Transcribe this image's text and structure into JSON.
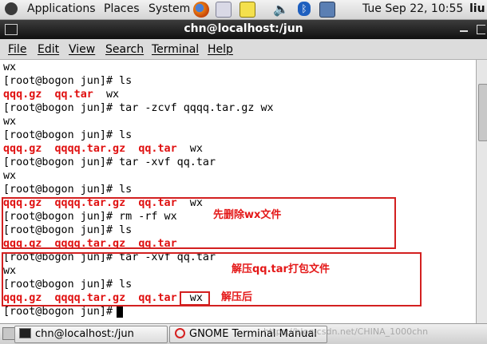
{
  "top_panel": {
    "applications": "Applications",
    "places": "Places",
    "system": "System",
    "clock": "Tue Sep 22, 10:55",
    "user": "liu"
  },
  "window": {
    "title": "chn@localhost:/jun",
    "menu": [
      "File",
      "Edit",
      "View",
      "Search",
      "Terminal",
      "Help"
    ]
  },
  "terminal": {
    "lines": [
      [
        {
          "t": "wx"
        }
      ],
      [
        {
          "t": "[root@bogon jun]# ls"
        }
      ],
      [
        {
          "t": "qqq.gz",
          "c": "red"
        },
        {
          "t": "  "
        },
        {
          "t": "qq.tar",
          "c": "red"
        },
        {
          "t": "  wx"
        }
      ],
      [
        {
          "t": "[root@bogon jun]# tar -zcvf qqqq.tar.gz wx"
        }
      ],
      [
        {
          "t": "wx"
        }
      ],
      [
        {
          "t": "[root@bogon jun]# ls"
        }
      ],
      [
        {
          "t": "qqq.gz",
          "c": "red"
        },
        {
          "t": "  "
        },
        {
          "t": "qqqq.tar.gz",
          "c": "red"
        },
        {
          "t": "  "
        },
        {
          "t": "qq.tar",
          "c": "red"
        },
        {
          "t": "  wx"
        }
      ],
      [
        {
          "t": "[root@bogon jun]# tar -xvf qq.tar"
        }
      ],
      [
        {
          "t": "wx"
        }
      ],
      [
        {
          "t": "[root@bogon jun]# ls"
        }
      ],
      [
        {
          "t": "qqq.gz",
          "c": "red"
        },
        {
          "t": "  "
        },
        {
          "t": "qqqq.tar.gz",
          "c": "red"
        },
        {
          "t": "  "
        },
        {
          "t": "qq.tar",
          "c": "red"
        },
        {
          "t": "  wx"
        }
      ],
      [
        {
          "t": "[root@bogon jun]# rm -rf wx"
        }
      ],
      [
        {
          "t": "[root@bogon jun]# ls"
        }
      ],
      [
        {
          "t": "qqq.gz",
          "c": "red"
        },
        {
          "t": "  "
        },
        {
          "t": "qqqq.tar.gz",
          "c": "red"
        },
        {
          "t": "  "
        },
        {
          "t": "qq.tar",
          "c": "red"
        }
      ],
      [
        {
          "t": "[root@bogon jun]# tar -xvf qq.tar"
        }
      ],
      [
        {
          "t": "wx"
        }
      ],
      [
        {
          "t": "[root@bogon jun]# ls"
        }
      ],
      [
        {
          "t": "qqq.gz",
          "c": "red"
        },
        {
          "t": "  "
        },
        {
          "t": "qqqq.tar.gz",
          "c": "red"
        },
        {
          "t": "  "
        },
        {
          "t": "qq.tar",
          "c": "red"
        },
        {
          "t": "  wx"
        }
      ],
      [
        {
          "t": "[root@bogon jun]# "
        }
      ]
    ]
  },
  "annotations": {
    "delete_wx": "先删除wx文件",
    "extract_tar": "解压qq.tar打包文件",
    "after_extract": "解压后"
  },
  "taskbar": {
    "task1": "chn@localhost:/jun",
    "task2": "GNOME Terminal Manual"
  },
  "watermark": "https://blog.csdn.net/CHINA_1000chn",
  "colors": {
    "file_red": "#e01010",
    "annotation_red": "#d32020"
  },
  "icons": [
    "gnome-foot-icon",
    "firefox-icon",
    "mail-icon",
    "notes-icon",
    "volume-icon",
    "bluetooth-icon",
    "network-icon",
    "terminal-icon",
    "help-icon"
  ]
}
